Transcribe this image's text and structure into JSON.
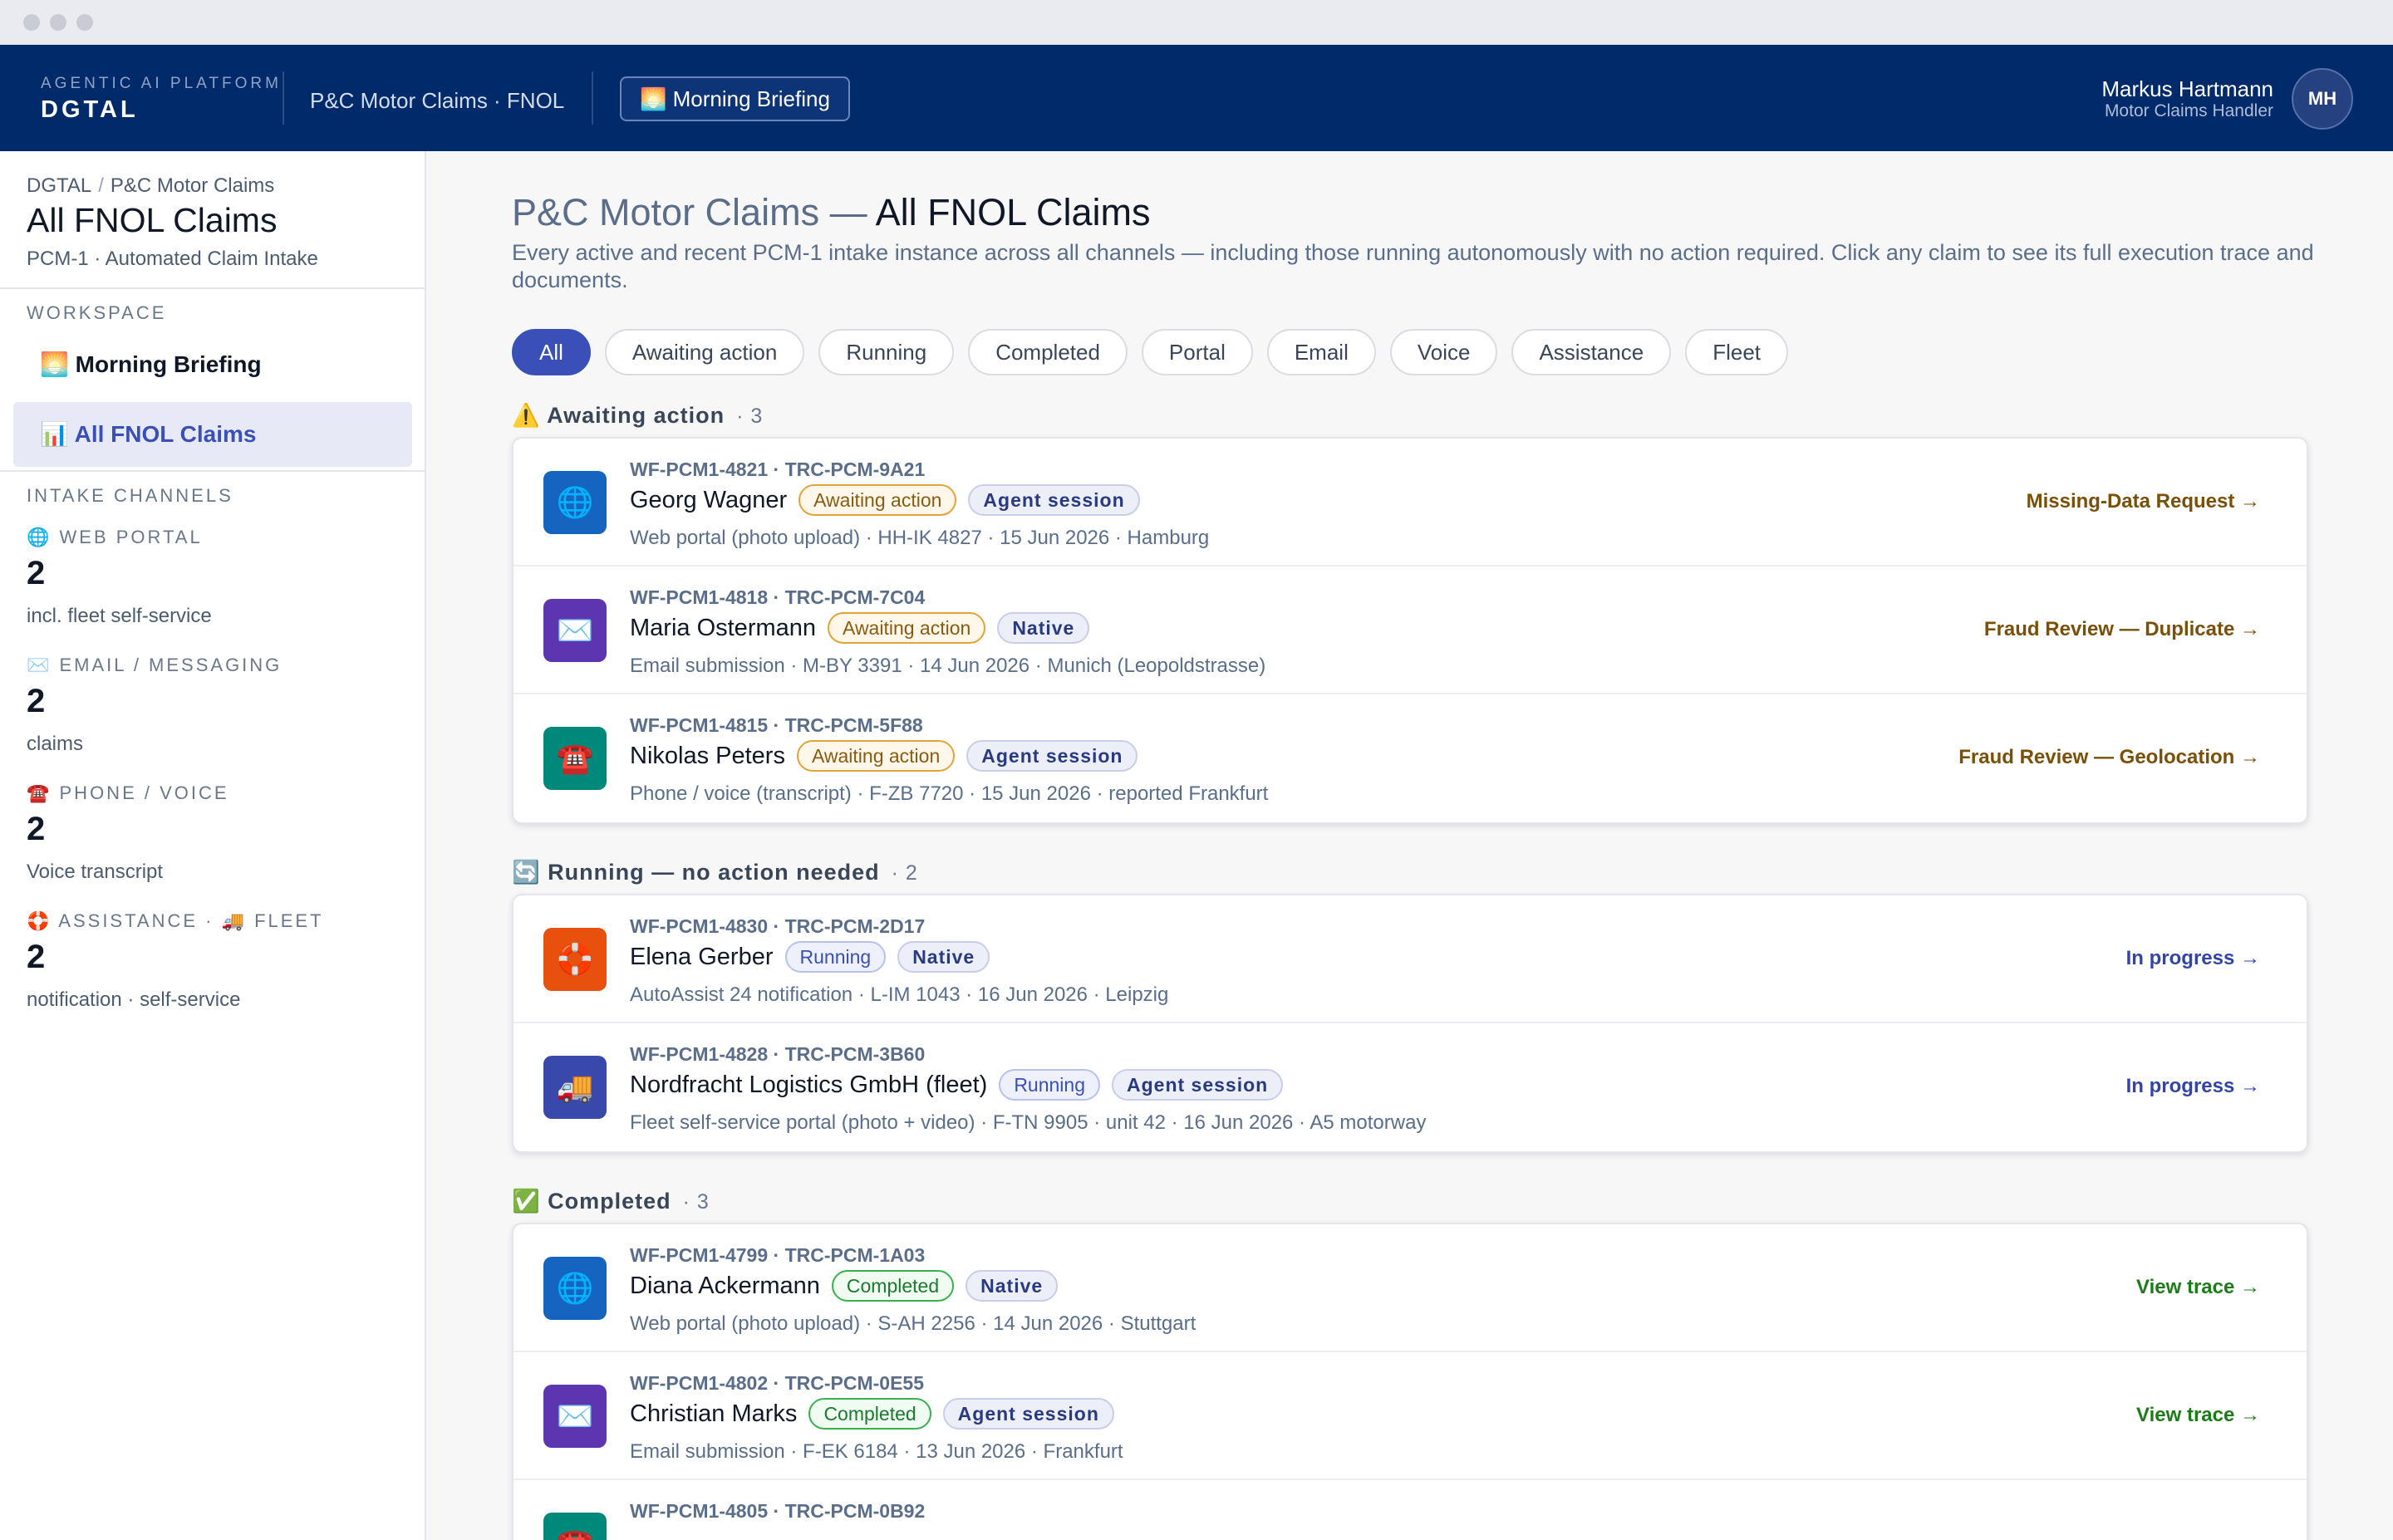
{
  "header": {
    "brand_sub": "AGENTIC AI PLATFORM",
    "brand": "DGTAL",
    "context": "P&C Motor Claims · FNOL",
    "briefing_button": "🌅 Morning Briefing",
    "user_name": "Markus Hartmann",
    "user_role": "Motor Claims Handler",
    "avatar_initials": "MH"
  },
  "sidebar": {
    "breadcrumb": [
      "DGTAL",
      "P&C Motor Claims"
    ],
    "breadcrumb_sep": "/",
    "title": "All FNOL Claims",
    "subtitle": "PCM-1 · Automated Claim Intake",
    "workspace_label": "WORKSPACE",
    "items": [
      {
        "label": "🌅 Morning Briefing"
      },
      {
        "label": "📊 All FNOL Claims"
      }
    ],
    "channels_label": "INTAKE CHANNELS",
    "channels": [
      {
        "label": "🌐 WEB PORTAL",
        "count": "2",
        "note": "incl. fleet self-service"
      },
      {
        "label": "✉️ EMAIL / MESSAGING",
        "count": "2",
        "note": "claims"
      },
      {
        "label": "☎️ PHONE / VOICE",
        "count": "2",
        "note": "Voice transcript"
      },
      {
        "label": "🛟 ASSISTANCE · 🚚 FLEET",
        "count": "2",
        "note": "notification · self-service"
      }
    ]
  },
  "main": {
    "title_prefix": "P&C Motor Claims — ",
    "title": "All FNOL Claims",
    "description": "Every active and recent PCM-1 intake instance across all channels — including those running autonomously with no action required. Click any claim to see its full execution trace and documents.",
    "filters": [
      "All",
      "Awaiting action",
      "Running",
      "Completed",
      "Portal",
      "Email",
      "Voice",
      "Assistance",
      "Fleet"
    ],
    "active_filter": "All",
    "groups": [
      {
        "heading": "⚠️ Awaiting action",
        "count": "· 3",
        "rows": [
          {
            "icon": "🌐",
            "icon_color": "#1565c0",
            "ids": "WF-PCM1-4821 · TRC-PCM-9A21",
            "name": "Georg Wagner",
            "status": "Awaiting action",
            "tag": "Agent session",
            "meta": "Web portal (photo upload) · HH-IK 4827 · 15 Jun 2026 · Hamburg",
            "action": "Missing-Data Request →"
          },
          {
            "icon": "✉️",
            "icon_color": "#5e35b1",
            "ids": "WF-PCM1-4818 · TRC-PCM-7C04",
            "name": "Maria Ostermann",
            "status": "Awaiting action",
            "tag": "Native",
            "meta": "Email submission · M-BY 3391 · 14 Jun 2026 · Munich (Leopoldstrasse)",
            "action": "Fraud Review — Duplicate →"
          },
          {
            "icon": "☎️",
            "icon_color": "#00897b",
            "ids": "WF-PCM1-4815 · TRC-PCM-5F88",
            "name": "Nikolas Peters",
            "status": "Awaiting action",
            "tag": "Agent session",
            "meta": "Phone / voice (transcript) · F-ZB 7720 · 15 Jun 2026 · reported Frankfurt",
            "action": "Fraud Review — Geolocation →"
          }
        ]
      },
      {
        "heading": "🔄 Running — no action needed",
        "count": "· 2",
        "rows": [
          {
            "icon": "🛟",
            "icon_color": "#e8500e",
            "ids": "WF-PCM1-4830 · TRC-PCM-2D17",
            "name": "Elena Gerber",
            "status": "Running",
            "tag": "Native",
            "meta": "AutoAssist 24 notification · L-IM 1043 · 16 Jun 2026 · Leipzig",
            "action": "In progress →"
          },
          {
            "icon": "🚚",
            "icon_color": "#3949ab",
            "ids": "WF-PCM1-4828 · TRC-PCM-3B60",
            "name": "Nordfracht Logistics GmbH (fleet)",
            "status": "Running",
            "tag": "Agent session",
            "meta": "Fleet self-service portal (photo + video) · F-TN 9905 · unit 42 · 16 Jun 2026 · A5 motorway",
            "action": "In progress →"
          }
        ]
      },
      {
        "heading": "✅ Completed",
        "count": "· 3",
        "rows": [
          {
            "icon": "🌐",
            "icon_color": "#1565c0",
            "ids": "WF-PCM1-4799 · TRC-PCM-1A03",
            "name": "Diana Ackermann",
            "status": "Completed",
            "tag": "Native",
            "meta": "Web portal (photo upload) · S-AH 2256 · 14 Jun 2026 · Stuttgart",
            "action": "View trace →"
          },
          {
            "icon": "✉️",
            "icon_color": "#5e35b1",
            "ids": "WF-PCM1-4802 · TRC-PCM-0E55",
            "name": "Christian Marks",
            "status": "Completed",
            "tag": "Agent session",
            "meta": "Email submission · F-EK 6184 · 13 Jun 2026 · Frankfurt",
            "action": "View trace →"
          },
          {
            "icon": "☎️",
            "icon_color": "#00897b",
            "ids": "WF-PCM1-4805 · TRC-PCM-0B92",
            "name": "",
            "status": "",
            "tag": "",
            "meta": "",
            "action": ""
          }
        ]
      }
    ]
  }
}
